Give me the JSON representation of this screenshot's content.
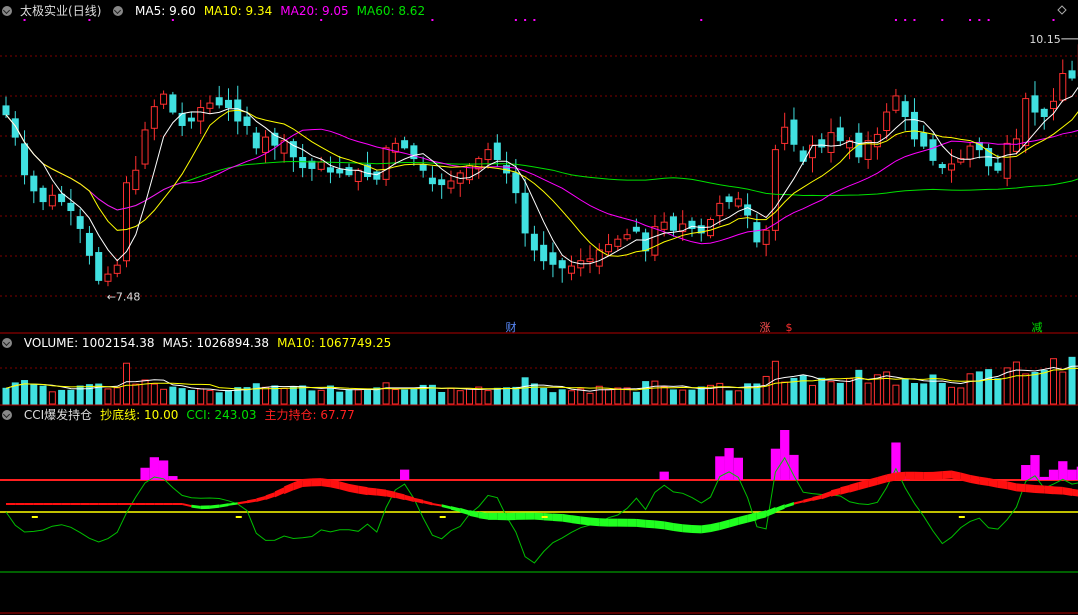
{
  "stock": {
    "name": "太极实业",
    "period": "(日线)"
  },
  "price_indicators": [
    {
      "label": "MA5: ",
      "value": "9.60",
      "color": "#ffffff"
    },
    {
      "label": "MA10: ",
      "value": "9.34",
      "color": "#ffff00"
    },
    {
      "label": "MA20: ",
      "value": "9.05",
      "color": "#ff00ff"
    },
    {
      "label": "MA60: ",
      "value": "8.62",
      "color": "#00e000"
    }
  ],
  "price_annotations": {
    "high": "10.15",
    "low": "7.48"
  },
  "events": [
    {
      "text": "财",
      "color": "#5a8cff"
    },
    {
      "text": "涨",
      "color": "#ff5050"
    },
    {
      "text": "$",
      "color": "#ff3030"
    },
    {
      "text": "减",
      "color": "#00e000"
    }
  ],
  "volume_indicators": [
    {
      "label": "VOLUME: ",
      "value": "1002154.38",
      "color": "#ffffff"
    },
    {
      "label": "MA5: ",
      "value": "1026894.38",
      "color": "#ffffff"
    },
    {
      "label": "MA10: ",
      "value": "1067749.25",
      "color": "#ffff00"
    }
  ],
  "cci_indicators": [
    {
      "label": "CCI爆发持仓",
      "value": "",
      "color": "#dddddd"
    },
    {
      "label": "抄底线: ",
      "value": "10.00",
      "color": "#ffff00"
    },
    {
      "label": "CCI: ",
      "value": "243.03",
      "color": "#00e000"
    },
    {
      "label": "主力持仓: ",
      "value": "67.77",
      "color": "#ff2020"
    }
  ],
  "colors": {
    "up": "#ff3030",
    "down": "#40e0e0",
    "grid": "#800000",
    "ma5": "#ffffff",
    "ma10": "#ffff00",
    "ma20": "#ff00ff",
    "ma60": "#00e000"
  },
  "chart_data": {
    "type": "candlestick",
    "price_ylim": [
      7.1,
      10.45
    ],
    "close": [
      9.37,
      9.12,
      8.7,
      8.52,
      8.4,
      8.47,
      8.4,
      8.3,
      8.1,
      7.8,
      7.52,
      7.59,
      7.69,
      8.61,
      8.75,
      9.2,
      9.46,
      9.6,
      9.4,
      9.25,
      9.3,
      9.45,
      9.5,
      9.48,
      9.45,
      9.3,
      9.25,
      9.0,
      9.12,
      9.03,
      9.08,
      8.9,
      8.78,
      8.77,
      8.84,
      8.73,
      8.72,
      8.7,
      8.75,
      8.68,
      8.65,
      9.0,
      9.05,
      9.0,
      8.88,
      8.75,
      8.6,
      8.59,
      8.63,
      8.72,
      8.8,
      8.88,
      8.98,
      8.87,
      8.72,
      8.5,
      8.05,
      7.86,
      7.74,
      7.7,
      7.66,
      7.68,
      7.74,
      7.76,
      7.86,
      7.92,
      7.98,
      8.03,
      8.07,
      7.85,
      8.12,
      8.17,
      8.08,
      8.15,
      8.1,
      8.05,
      8.2,
      8.38,
      8.4,
      8.43,
      8.25,
      7.95,
      8.08,
      8.98,
      9.23,
      9.04,
      8.85,
      9.03,
      9.01,
      9.17,
      9.08,
      9.08,
      8.9,
      9.08,
      9.15,
      9.4,
      9.58,
      9.35,
      9.1,
      9.02,
      8.86,
      8.78,
      8.82,
      8.88,
      9.02,
      8.98,
      8.8,
      8.75,
      9.05,
      9.1,
      9.55,
      9.4,
      9.35,
      9.52,
      9.83,
      9.78,
      10.15
    ]
  }
}
